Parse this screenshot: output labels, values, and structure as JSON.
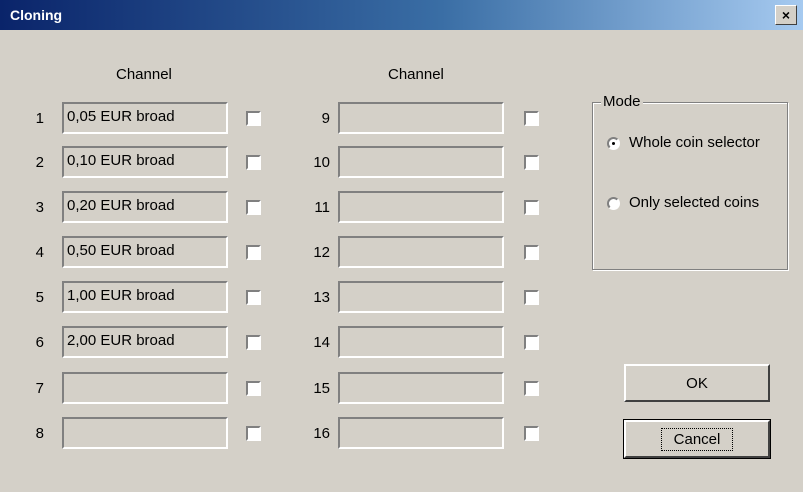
{
  "window": {
    "title": "Cloning",
    "close_label": "×"
  },
  "columns": {
    "left_header": "Channel",
    "right_header": "Channel"
  },
  "left_channels": [
    {
      "num": "1",
      "value": "0,05 EUR broad"
    },
    {
      "num": "2",
      "value": "0,10 EUR broad"
    },
    {
      "num": "3",
      "value": "0,20 EUR broad"
    },
    {
      "num": "4",
      "value": "0,50 EUR broad"
    },
    {
      "num": "5",
      "value": "1,00 EUR broad"
    },
    {
      "num": "6",
      "value": "2,00 EUR broad"
    },
    {
      "num": "7",
      "value": ""
    },
    {
      "num": "8",
      "value": ""
    }
  ],
  "right_channels": [
    {
      "num": "9",
      "value": ""
    },
    {
      "num": "10",
      "value": ""
    },
    {
      "num": "11",
      "value": ""
    },
    {
      "num": "12",
      "value": ""
    },
    {
      "num": "13",
      "value": ""
    },
    {
      "num": "14",
      "value": ""
    },
    {
      "num": "15",
      "value": ""
    },
    {
      "num": "16",
      "value": ""
    }
  ],
  "mode": {
    "label": "Mode",
    "option1": "Whole coin selector",
    "option2": "Only selected coins",
    "selected": "Whole coin selector"
  },
  "buttons": {
    "ok": "OK",
    "cancel": "Cancel"
  }
}
